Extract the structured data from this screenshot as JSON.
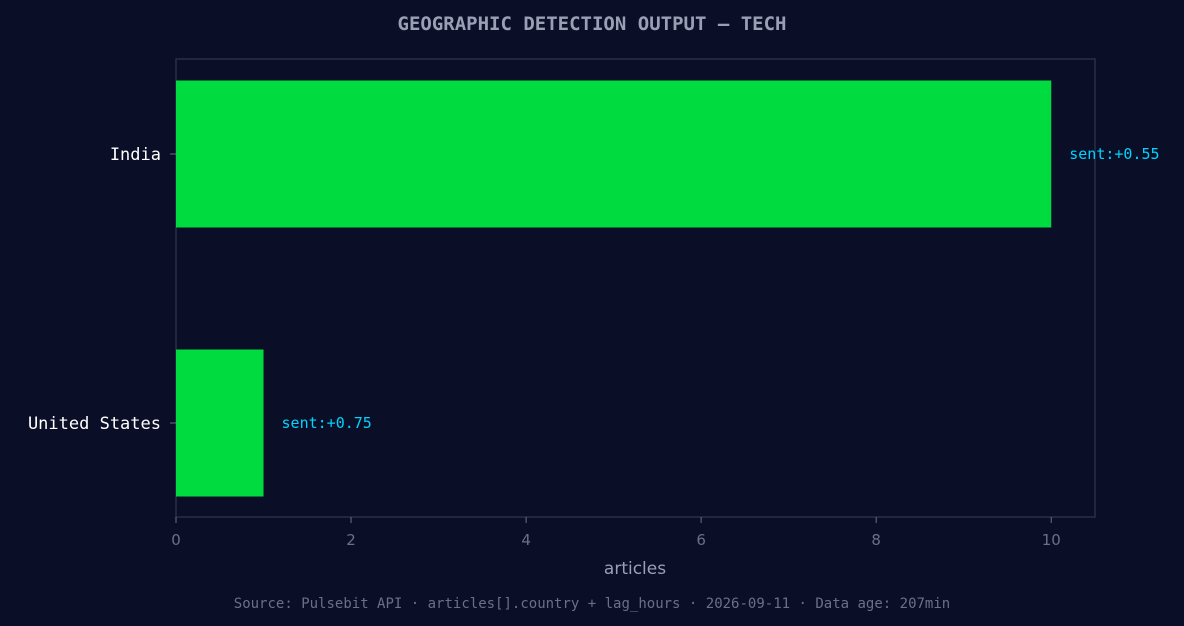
{
  "chart_data": {
    "type": "bar",
    "orientation": "horizontal",
    "title": "GEOGRAPHIC DETECTION OUTPUT — TECH",
    "xlabel": "articles",
    "ylabel": "",
    "categories": [
      "India",
      "United States"
    ],
    "values": [
      10,
      1
    ],
    "data_labels": [
      "sent:+0.55",
      "sent:+0.75"
    ],
    "xlim": [
      0,
      10.5
    ],
    "x_ticks": [
      0,
      2,
      4,
      6,
      8,
      10
    ],
    "grid": false,
    "legend": "none"
  },
  "footer": {
    "source": "Source: Pulsebit API · articles[].country + lag_hours · 2026-09-11 · Data age: 207min"
  },
  "colors": {
    "background": "#0a0e27",
    "bar": "#00dc3f",
    "data_label": "#00d4ff",
    "frame": "#2a2f4a"
  }
}
